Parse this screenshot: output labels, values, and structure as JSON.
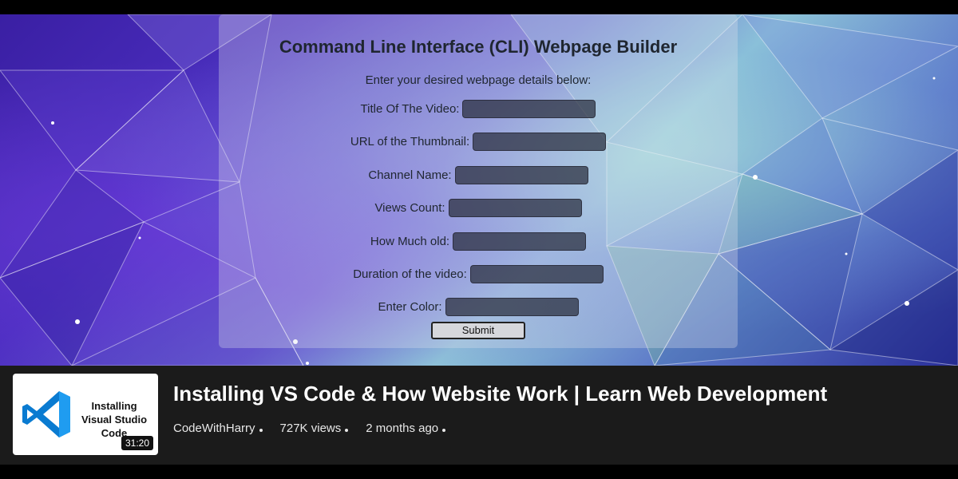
{
  "form": {
    "title": "Command Line Interface (CLI) Webpage Builder",
    "instructions": "Enter your desired webpage details below:",
    "fields": [
      {
        "label": "Title Of The Video:",
        "value": ""
      },
      {
        "label": "URL of the Thumbnail:",
        "value": ""
      },
      {
        "label": "Channel Name:",
        "value": ""
      },
      {
        "label": "Views Count:",
        "value": ""
      },
      {
        "label": "How Much old:",
        "value": ""
      },
      {
        "label": "Duration of the video:",
        "value": ""
      },
      {
        "label": "Enter Color:",
        "value": ""
      }
    ],
    "submit_label": "Submit"
  },
  "video": {
    "thumbnail_text": "Installing Visual Studio Code",
    "thumbnail_icon": "vscode-logo-icon",
    "duration": "31:20",
    "title": "Installing VS Code & How Website Work | Learn Web Development",
    "channel": "CodeWithHarry",
    "views": "727K views",
    "age": "2 months ago"
  },
  "colors": {
    "panel_bg": "#dfe3eb",
    "input_bg": "#2d3140",
    "info_bg": "#1b1b1b",
    "vscode_blue": "#0a7bd1"
  }
}
